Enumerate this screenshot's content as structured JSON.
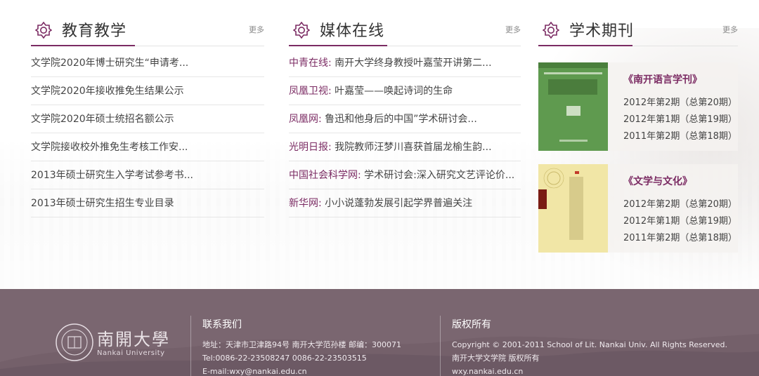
{
  "sections": [
    {
      "title": "教育教学",
      "more": "更多",
      "items": [
        {
          "source": "",
          "text": "文学院2020年博士研究生“申请考..."
        },
        {
          "source": "",
          "text": "文学院2020年接收推免生结果公示"
        },
        {
          "source": "",
          "text": "文学院2020年硕士统招名额公示"
        },
        {
          "source": "",
          "text": "文学院接收校外推免生考核工作安..."
        },
        {
          "source": "",
          "text": "2013年硕士研究生入学考试参考书..."
        },
        {
          "source": "",
          "text": "2013年硕士研究生招生专业目录"
        }
      ]
    },
    {
      "title": "媒体在线",
      "more": "更多",
      "items": [
        {
          "source": "中青在线:",
          "text": " 南开大学终身教授叶嘉莹开讲第二..."
        },
        {
          "source": "凤凰卫视:",
          "text": " 叶嘉莹——唤起诗词的生命"
        },
        {
          "source": "凤凰网:",
          "text": " 鲁迅和他身后的中国”学术研讨会..."
        },
        {
          "source": "光明日报:",
          "text": " 我院教师汪梦川喜获首届龙榆生韵..."
        },
        {
          "source": "中国社会科学网:",
          "text": " 学术研讨会:深入研究文艺评论价..."
        },
        {
          "source": "新华网:",
          "text": " 小小说蓬勃发展引起学界普遍关注"
        }
      ]
    },
    {
      "title": "学术期刊",
      "more": "更多",
      "journals": [
        {
          "title": "《南开语言学刊》",
          "issues": [
            "2012年第2期（总第20期）",
            "2012年第1期（总第19期）",
            "2011年第2期（总第18期）"
          ],
          "cover_color": "#5f9a4f"
        },
        {
          "title": "《文学与文化》",
          "issues": [
            "2012年第2期（总第20期）",
            "2012年第1期（总第19期）",
            "2011年第2期（总第18期）"
          ],
          "cover_color": "#f1e6a6"
        }
      ]
    }
  ],
  "footer": {
    "logo_name": "南開大學",
    "logo_en": "Nankai University",
    "contact_title": "联系我们",
    "contact_lines": [
      "地址：天津市卫津路94号 南开大学范孙楼 邮编：300071",
      "Tel:0086-22-23508247 0086-22-23503515",
      "E-mail:wxy@nankai.edu.cn"
    ],
    "copyright_title": "版权所有",
    "copyright_lines": [
      "Copyright © 2001-2011 School of Lit. Nankai Univ. All Rights Reserved.",
      "南开大学文学院 版权所有",
      "wxy.nankai.edu.cn"
    ],
    "bg_color": "#7a6670"
  },
  "accent": "#7b2b63"
}
